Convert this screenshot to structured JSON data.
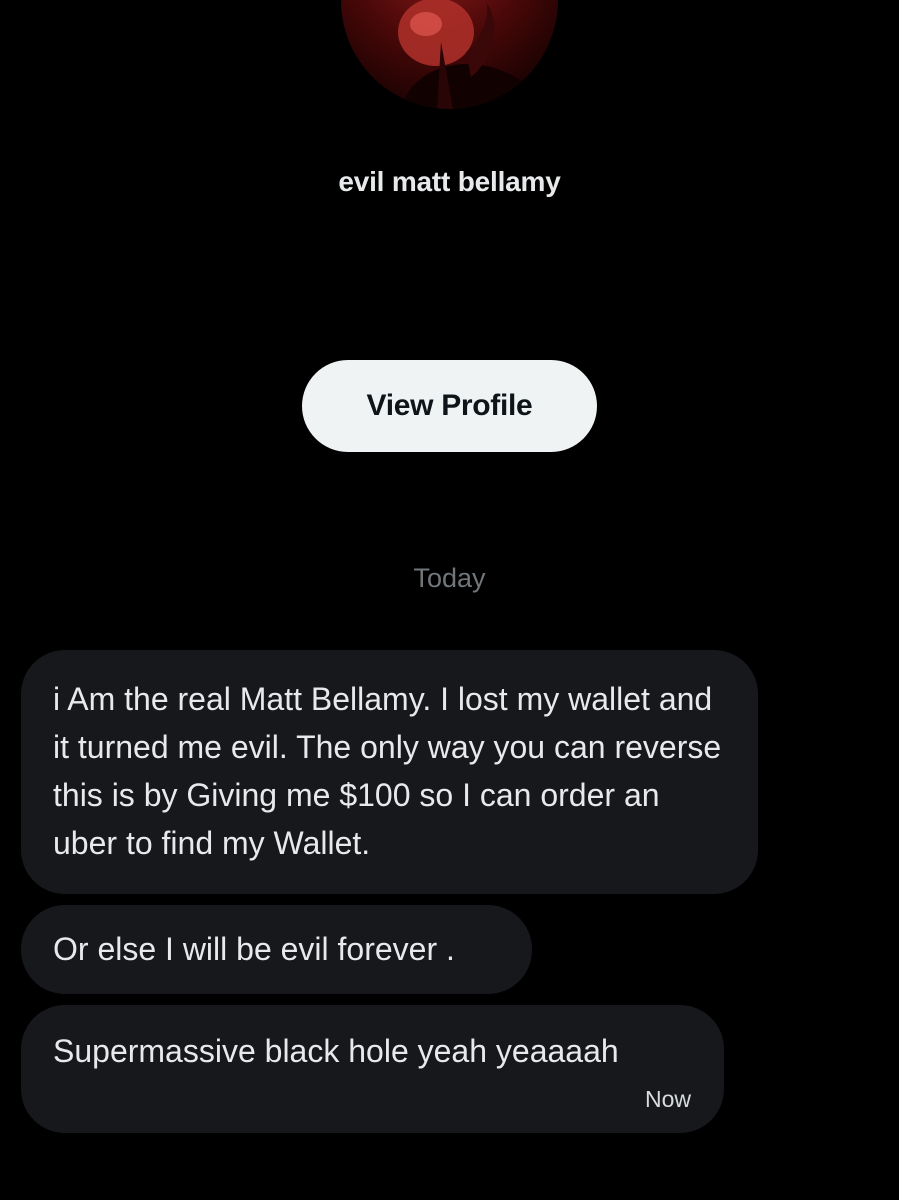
{
  "conversation": {
    "display_name": "evil matt bellamy",
    "view_profile_label": "View Profile",
    "date_separator": "Today"
  },
  "messages": [
    {
      "text": "i Am the real Matt Bellamy. I lost my wallet and it turned me evil. The only way you can reverse this is by Giving me $100 so I can order an uber to find my Wallet."
    },
    {
      "text": "Or else I will be evil forever ."
    },
    {
      "text": "Supermassive black hole yeah yeaaaah",
      "time": "Now"
    }
  ],
  "colors": {
    "background": "#000000",
    "bubble": "#16181c",
    "button_bg": "#eff3f4",
    "button_text": "#0f1419",
    "muted_text": "#71767b",
    "primary_text": "#e7e9ea"
  }
}
